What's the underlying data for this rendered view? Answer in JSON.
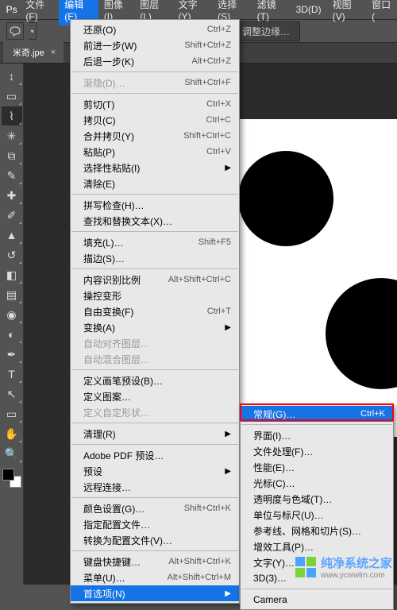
{
  "menubar": {
    "logo": "Ps",
    "items": [
      "文件(F)",
      "编辑(E)",
      "图像(I)",
      "图层(L)",
      "文字(Y)",
      "选择(S)",
      "滤镜(T)",
      "3D(D)",
      "视图(V)",
      "窗口("
    ],
    "active_index": 1
  },
  "optionsbar": {
    "button_refine_edge": "调整边缘…"
  },
  "tab": {
    "title": "米奇.jpe",
    "close": "×"
  },
  "tools": [
    {
      "name": "move-tool",
      "glyph": "↕"
    },
    {
      "name": "marquee-tool",
      "glyph": "▭"
    },
    {
      "name": "lasso-tool",
      "glyph": "⌇",
      "selected": true
    },
    {
      "name": "magic-wand-tool",
      "glyph": "✳"
    },
    {
      "name": "crop-tool",
      "glyph": "⧉"
    },
    {
      "name": "eyedropper-tool",
      "glyph": "✎"
    },
    {
      "name": "spot-heal-tool",
      "glyph": "✚"
    },
    {
      "name": "brush-tool",
      "glyph": "✐"
    },
    {
      "name": "clone-stamp-tool",
      "glyph": "▲"
    },
    {
      "name": "history-brush-tool",
      "glyph": "↺"
    },
    {
      "name": "eraser-tool",
      "glyph": "◧"
    },
    {
      "name": "gradient-tool",
      "glyph": "▤"
    },
    {
      "name": "blur-tool",
      "glyph": "◉"
    },
    {
      "name": "dodge-tool",
      "glyph": "◐"
    },
    {
      "name": "pen-tool",
      "glyph": "✒"
    },
    {
      "name": "type-tool",
      "glyph": "T"
    },
    {
      "name": "path-select-tool",
      "glyph": "↖"
    },
    {
      "name": "shape-tool",
      "glyph": "▭"
    },
    {
      "name": "hand-tool",
      "glyph": "✋"
    },
    {
      "name": "zoom-tool",
      "glyph": "🔍"
    }
  ],
  "edit_menu": [
    {
      "type": "item",
      "label": "还原(O)",
      "shortcut": "Ctrl+Z"
    },
    {
      "type": "item",
      "label": "前进一步(W)",
      "shortcut": "Shift+Ctrl+Z"
    },
    {
      "type": "item",
      "label": "后退一步(K)",
      "shortcut": "Alt+Ctrl+Z"
    },
    {
      "type": "sep"
    },
    {
      "type": "item",
      "label": "渐隐(D)…",
      "shortcut": "Shift+Ctrl+F",
      "disabled": true
    },
    {
      "type": "sep"
    },
    {
      "type": "item",
      "label": "剪切(T)",
      "shortcut": "Ctrl+X"
    },
    {
      "type": "item",
      "label": "拷贝(C)",
      "shortcut": "Ctrl+C"
    },
    {
      "type": "item",
      "label": "合并拷贝(Y)",
      "shortcut": "Shift+Ctrl+C"
    },
    {
      "type": "item",
      "label": "粘贴(P)",
      "shortcut": "Ctrl+V"
    },
    {
      "type": "item",
      "label": "选择性粘贴(I)",
      "submenu": true
    },
    {
      "type": "item",
      "label": "清除(E)"
    },
    {
      "type": "sep"
    },
    {
      "type": "item",
      "label": "拼写检查(H)…"
    },
    {
      "type": "item",
      "label": "查找和替换文本(X)…"
    },
    {
      "type": "sep"
    },
    {
      "type": "item",
      "label": "填充(L)…",
      "shortcut": "Shift+F5"
    },
    {
      "type": "item",
      "label": "描边(S)…"
    },
    {
      "type": "sep"
    },
    {
      "type": "item",
      "label": "内容识别比例",
      "shortcut": "Alt+Shift+Ctrl+C"
    },
    {
      "type": "item",
      "label": "操控变形"
    },
    {
      "type": "item",
      "label": "自由变换(F)",
      "shortcut": "Ctrl+T"
    },
    {
      "type": "item",
      "label": "变换(A)",
      "submenu": true
    },
    {
      "type": "item",
      "label": "自动对齐图层…",
      "disabled": true
    },
    {
      "type": "item",
      "label": "自动混合图层…",
      "disabled": true
    },
    {
      "type": "sep"
    },
    {
      "type": "item",
      "label": "定义画笔预设(B)…"
    },
    {
      "type": "item",
      "label": "定义图案…"
    },
    {
      "type": "item",
      "label": "定义自定形状…",
      "disabled": true
    },
    {
      "type": "sep"
    },
    {
      "type": "item",
      "label": "清理(R)",
      "submenu": true
    },
    {
      "type": "sep"
    },
    {
      "type": "item",
      "label": "Adobe PDF 预设…"
    },
    {
      "type": "item",
      "label": "预设",
      "submenu": true
    },
    {
      "type": "item",
      "label": "远程连接…"
    },
    {
      "type": "sep"
    },
    {
      "type": "item",
      "label": "颜色设置(G)…",
      "shortcut": "Shift+Ctrl+K"
    },
    {
      "type": "item",
      "label": "指定配置文件…"
    },
    {
      "type": "item",
      "label": "转换为配置文件(V)…"
    },
    {
      "type": "sep"
    },
    {
      "type": "item",
      "label": "键盘快捷键…",
      "shortcut": "Alt+Shift+Ctrl+K"
    },
    {
      "type": "item",
      "label": "菜单(U)…",
      "shortcut": "Alt+Shift+Ctrl+M"
    },
    {
      "type": "item",
      "label": "首选项(N)",
      "submenu": true,
      "hover": true
    }
  ],
  "prefs_submenu": [
    {
      "type": "item",
      "label": "常规(G)…",
      "shortcut": "Ctrl+K",
      "hover": true
    },
    {
      "type": "sep"
    },
    {
      "type": "item",
      "label": "界面(I)…"
    },
    {
      "type": "item",
      "label": "文件处理(F)…"
    },
    {
      "type": "item",
      "label": "性能(E)…"
    },
    {
      "type": "item",
      "label": "光标(C)…"
    },
    {
      "type": "item",
      "label": "透明度与色域(T)…"
    },
    {
      "type": "item",
      "label": "单位与标尺(U)…"
    },
    {
      "type": "item",
      "label": "参考线、网格和切片(S)…"
    },
    {
      "type": "item",
      "label": "增效工具(P)…"
    },
    {
      "type": "item",
      "label": "文字(Y)…"
    },
    {
      "type": "item",
      "label": "3D(3)…"
    },
    {
      "type": "sep"
    },
    {
      "type": "item",
      "label": "Camera"
    }
  ],
  "watermark": {
    "title": "纯净系统之家",
    "url": "www.ycwwlm.com"
  }
}
